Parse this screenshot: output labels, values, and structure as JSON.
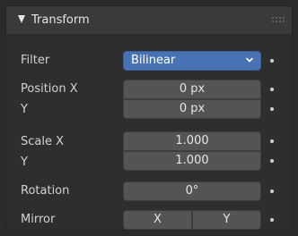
{
  "panel": {
    "title": "Transform",
    "icons": {
      "collapse": "triangle-down-icon",
      "grip": "drag-grip-icon"
    }
  },
  "filter": {
    "label": "Filter",
    "value": "Bilinear",
    "icon": "chevron-down-icon"
  },
  "position": {
    "x_label": "Position X",
    "x_value": "0 px",
    "y_label": "Y",
    "y_value": "0 px"
  },
  "scale": {
    "x_label": "Scale X",
    "x_value": "1.000",
    "y_label": "Y",
    "y_value": "1.000"
  },
  "rotation": {
    "label": "Rotation",
    "value": "0°"
  },
  "mirror": {
    "label": "Mirror",
    "x_label": "X",
    "y_label": "Y"
  },
  "colors": {
    "accent": "#4772b3",
    "field": "#545454",
    "panel": "#2e2e2e",
    "header": "#3a3a3a"
  }
}
